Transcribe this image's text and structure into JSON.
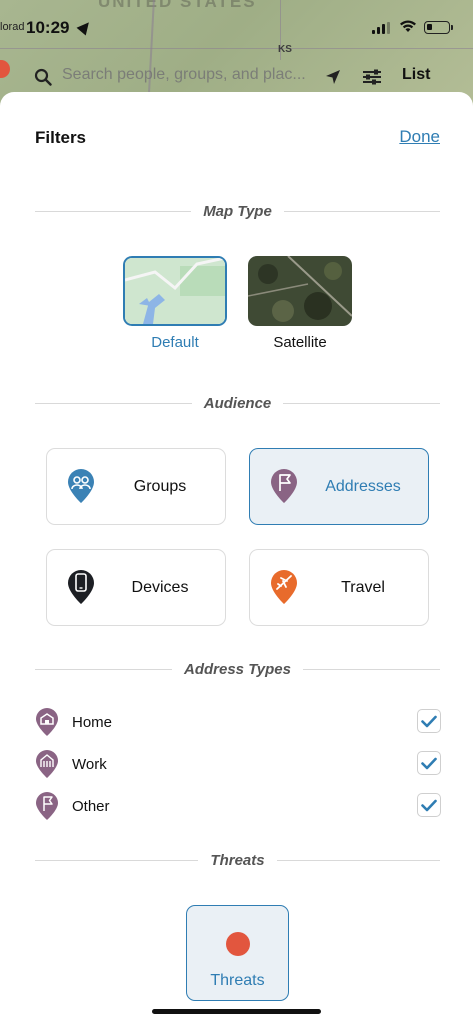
{
  "status": {
    "time": "10:29",
    "carrier_fragment": "lorad"
  },
  "map_bg": {
    "ghost_label": "UNITED STATES",
    "state_label": "KS"
  },
  "search": {
    "placeholder": "Search people, groups, and plac...",
    "list_label": "List"
  },
  "sheet": {
    "title": "Filters",
    "done_label": "Done"
  },
  "map_type": {
    "header": "Map Type",
    "options": [
      {
        "label": "Default",
        "selected": true
      },
      {
        "label": "Satellite",
        "selected": false
      }
    ]
  },
  "audience": {
    "header": "Audience",
    "cards": [
      {
        "label": "Groups",
        "icon": "groups-pin-icon",
        "color": "#3b82b5",
        "selected": false
      },
      {
        "label": "Addresses",
        "icon": "flag-pin-icon",
        "color": "#8a6484",
        "selected": true
      },
      {
        "label": "Devices",
        "icon": "device-pin-icon",
        "color": "#1d1f24",
        "selected": false
      },
      {
        "label": "Travel",
        "icon": "plane-pin-icon",
        "color": "#e86b2c",
        "selected": false
      }
    ]
  },
  "address_types": {
    "header": "Address Types",
    "items": [
      {
        "label": "Home",
        "icon": "home-pin-icon",
        "checked": true
      },
      {
        "label": "Work",
        "icon": "work-pin-icon",
        "checked": true
      },
      {
        "label": "Other",
        "icon": "flag-pin-icon",
        "checked": true
      }
    ]
  },
  "threats": {
    "header": "Threats",
    "card_label": "Threats",
    "dot_color": "#e2563e"
  },
  "colors": {
    "accent": "#2f7db3",
    "address_purple": "#8a6484"
  }
}
